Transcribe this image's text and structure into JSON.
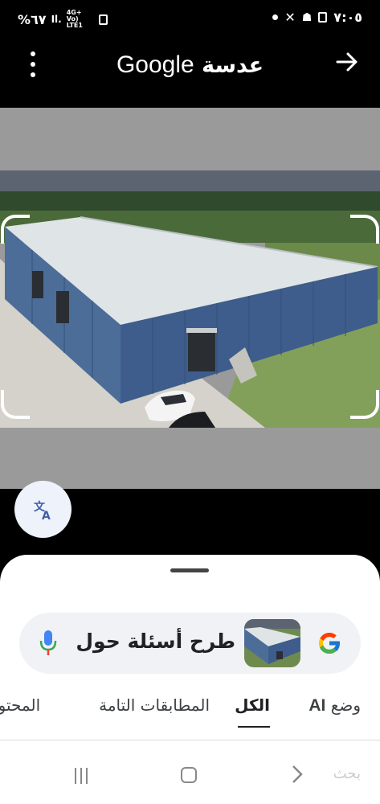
{
  "status_bar": {
    "battery": "%٦٧",
    "signal": "4G+ Vo) LTE1",
    "time": "٧:٠٥"
  },
  "header": {
    "title_google": "Google",
    "title_lens": "عدسة",
    "menu_icon": "more-vert-icon",
    "forward_icon": "arrow-forward-icon"
  },
  "search": {
    "placeholder": "طرح أسئلة حول",
    "mic_icon": "mic-icon"
  },
  "tabs": [
    {
      "label": "وضع",
      "label_ai": "AI"
    },
    {
      "label": "الكل",
      "active": true
    },
    {
      "label": "المطابقات التامة"
    },
    {
      "label": "المحتوى"
    }
  ],
  "nav": {
    "faded_label": "بحث"
  },
  "colors": {
    "wall": "#4a6c9b",
    "roof": "#d9dfe2",
    "accent_underline": "#202124"
  }
}
